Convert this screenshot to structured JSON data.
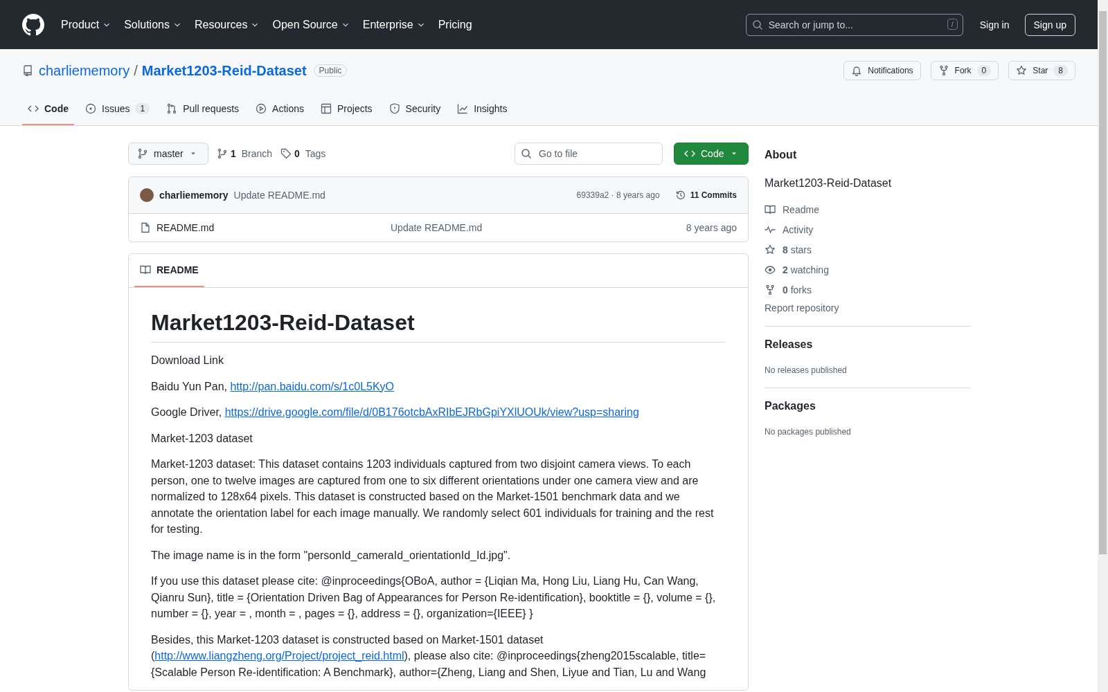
{
  "header": {
    "nav": [
      {
        "label": "Product",
        "caret": true
      },
      {
        "label": "Solutions",
        "caret": true
      },
      {
        "label": "Resources",
        "caret": true
      },
      {
        "label": "Open Source",
        "caret": true
      },
      {
        "label": "Enterprise",
        "caret": true
      },
      {
        "label": "Pricing",
        "caret": false
      }
    ],
    "search": {
      "placeholder": "Search or jump to...",
      "shortcut": "/"
    },
    "sign_in": "Sign in",
    "sign_up": "Sign up"
  },
  "repo": {
    "owner": "charliememory",
    "separator": "/",
    "name": "Market1203-Reid-Dataset",
    "visibility": "Public",
    "notifications": "Notifications",
    "fork": {
      "label": "Fork",
      "count": "0"
    },
    "star": {
      "label": "Star",
      "count": "8"
    }
  },
  "tabs": [
    {
      "label": "Code",
      "selected": true
    },
    {
      "label": "Issues",
      "count": "1",
      "selected": false
    },
    {
      "label": "Pull requests",
      "selected": false
    },
    {
      "label": "Actions",
      "selected": false
    },
    {
      "label": "Projects",
      "selected": false
    },
    {
      "label": "Security",
      "selected": false
    },
    {
      "label": "Insights",
      "selected": false
    }
  ],
  "toolbar": {
    "branch": "master",
    "branches": {
      "count": "1",
      "label": "Branch"
    },
    "tags": {
      "count": "0",
      "label": "Tags"
    },
    "go_to_file": {
      "placeholder": "Go to file"
    },
    "code_button": "Code"
  },
  "commit": {
    "author": "charliememory",
    "message": "Update README.md",
    "meta": "69339a2 · 8 years ago",
    "commits": "11 Commits"
  },
  "files": [
    {
      "name": "README.md",
      "message": "Update README.md",
      "age": "8 years ago"
    }
  ],
  "readme": {
    "tab": "README",
    "title": "Market1203-Reid-Dataset",
    "paragraphs": [
      [
        {
          "kind": "text",
          "text": "Download Link"
        }
      ],
      [
        {
          "kind": "text",
          "text": "Baidu Yun Pan, "
        },
        {
          "kind": "link",
          "text": "http://pan.baidu.com/s/1c0L5KyO"
        }
      ],
      [
        {
          "kind": "text",
          "text": "Google Driver, "
        },
        {
          "kind": "link",
          "text": "https://drive.google.com/file/d/0B176otcbAxRIbEJRbGpiYXlUOUk/view?usp=sharing"
        }
      ],
      [
        {
          "kind": "text",
          "text": "Market-1203 dataset"
        }
      ],
      [
        {
          "kind": "text",
          "text": "Market-1203 dataset: This dataset contains 1203 individuals captured from two disjoint camera views. To each person, one to twelve images are captured from one to six different orientations under one camera view and are normalized to 128x64 pixels. This dataset is constructed based on the Market-1501 benchmark data and we annotate the orientation label for each image manually. We randomly select 601 individuals for training and the rest for testing."
        }
      ],
      [
        {
          "kind": "text",
          "text": "The image name is in the form \"personId_cameraId_orientationId_Id.jpg\"."
        }
      ],
      [
        {
          "kind": "text",
          "text": "If you use this dataset please cite: @inproceedings{OBoA, author = {Liqian Ma, Hong Liu, Liang Hu, Can Wang, Qianru Sun}, title = {Orientation Driven Bag of Appearances for Person Re-identification}, booktitle = {}, volume = {}, number = {}, year = , month = , pages = {}, address = {}, organization={IEEE} }"
        }
      ],
      [
        {
          "kind": "text",
          "text": "Besides, this Market-1203 dataset is constructed based on Market-1501 dataset ("
        },
        {
          "kind": "link",
          "text": "http://www.liangzheng.org/Project/project_reid.html"
        },
        {
          "kind": "text",
          "text": "), please also cite: @inproceedings{zheng2015scalable, title={Scalable Person Re-identification: A Benchmark}, author={Zheng, Liang and Shen, Liyue and Tian, Lu and Wang"
        }
      ]
    ]
  },
  "about": {
    "heading": "About",
    "description": "Market1203-Reid-Dataset",
    "links": [
      "Readme",
      "Activity",
      "**8** stars",
      "**2** watching",
      "**0** forks"
    ],
    "report": "Report repository"
  },
  "releases": {
    "heading": "Releases",
    "note": "No releases published"
  },
  "packages": {
    "heading": "Packages",
    "note": "No packages published"
  }
}
